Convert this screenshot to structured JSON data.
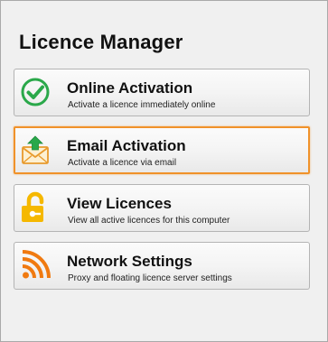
{
  "window": {
    "title": "Licence Manager"
  },
  "actions": [
    {
      "label": "Online Activation",
      "description": "Activate a licence immediately online",
      "icon": "green-checkmark-icon"
    },
    {
      "label": "Email Activation",
      "description": "Activate a licence via email",
      "icon": "envelope-upload-icon",
      "focused": true
    },
    {
      "label": "View Licences",
      "description": "View all active licences for this computer",
      "icon": "unlocked-padlock-icon"
    },
    {
      "label": "Network Settings",
      "description": "Proxy and floating licence server settings",
      "icon": "network-signal-icon"
    }
  ],
  "colors": {
    "focus_border": "#f0922a",
    "check_green": "#2aa84a",
    "lock_yellow": "#f5b800",
    "signal_orange": "#f07a10"
  }
}
